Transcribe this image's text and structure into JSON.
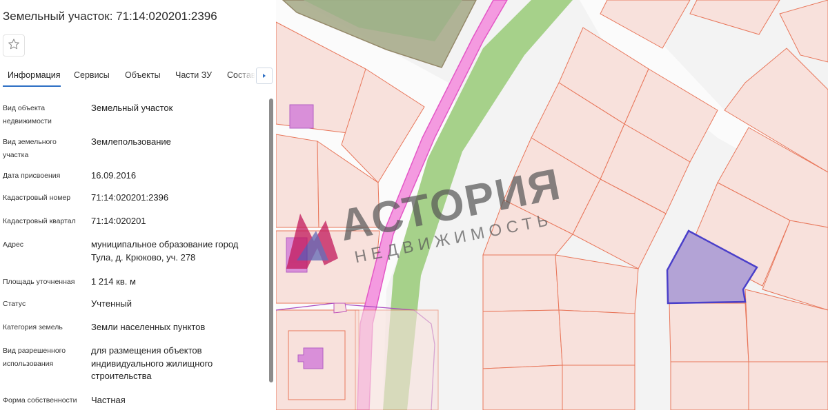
{
  "panel": {
    "title": "Земельный участок: 71:14:020201:2396",
    "star_icon": "star-outline-icon",
    "tabs": [
      {
        "label": "Информация",
        "active": true
      },
      {
        "label": "Сервисы",
        "active": false
      },
      {
        "label": "Объекты",
        "active": false
      },
      {
        "label": "Части ЗУ",
        "active": false
      },
      {
        "label": "Состав",
        "active": false
      }
    ],
    "tab_more_icon": "chevron-right-icon",
    "accent_color": "#2d6fc4",
    "fields": [
      {
        "label": "Вид объекта недвижимости",
        "value": "Земельный участок"
      },
      {
        "label": "Вид земельного участка",
        "value": "Землепользование"
      },
      {
        "label": "Дата присвоения",
        "value": "16.09.2016"
      },
      {
        "label": "Кадастровый номер",
        "value": "71:14:020201:2396"
      },
      {
        "label": "Кадастровый квартал",
        "value": "71:14:020201"
      },
      {
        "label": "Адрес",
        "value": "муниципальное образование город Тула, д. Крюково, уч. 278"
      },
      {
        "label": "Площадь уточненная",
        "value": "1 214 кв. м"
      },
      {
        "label": "Статус",
        "value": "Учтенный"
      },
      {
        "label": "Категория земель",
        "value": "Земли населенных пунктов"
      },
      {
        "label": "Вид разрешенного использования",
        "value": "для размещения объектов индивидуального жилищного строительства"
      },
      {
        "label": "Форма собственности",
        "value": "Частная"
      }
    ]
  },
  "map": {
    "parcel_fill": "#f8e1dc",
    "parcel_stroke": "#e8765a",
    "selected_fill": "#b3a3d6",
    "selected_stroke": "#4a3fc9",
    "building_fill": "#d98fd9",
    "green_strip": "#a6d18a",
    "pink_line": "#f06fd0"
  },
  "watermark": {
    "main_text": "АСТОРИЯ",
    "sub_text": "НЕДВИЖИМОСТЬ",
    "logo_icon": "astoria-logo-icon"
  }
}
